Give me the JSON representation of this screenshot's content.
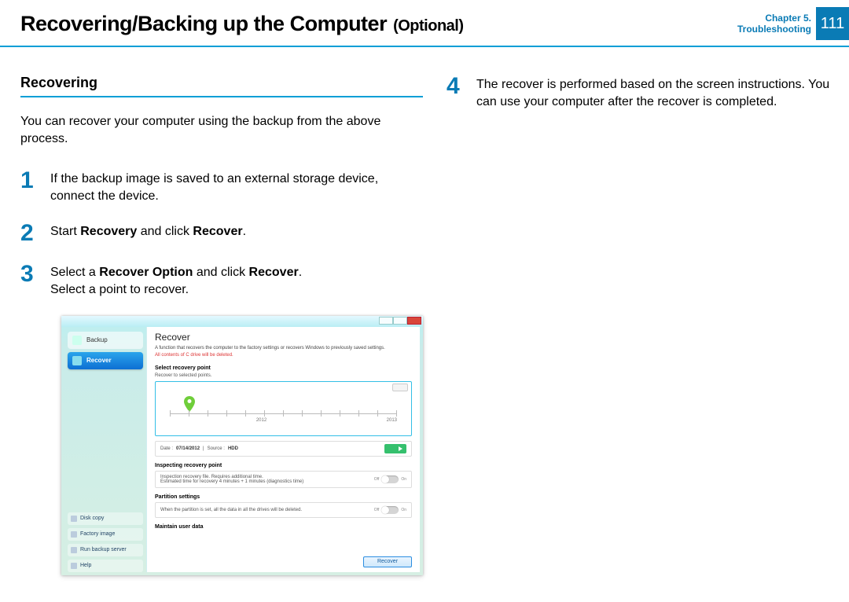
{
  "header": {
    "title": "Recovering/Backing up the Computer",
    "optional": "(Optional)",
    "chapter_line1": "Chapter 5.",
    "chapter_line2": "Troubleshooting",
    "page_number": "111"
  },
  "left": {
    "heading": "Recovering",
    "intro": "You can recover your computer using the backup from the above process.",
    "steps": [
      {
        "num": "1",
        "text_plain_a": "If the backup image is saved to an external storage device, connect the device."
      },
      {
        "num": "2",
        "text_a": "Start ",
        "b1": "Recovery",
        "text_b": " and click ",
        "b2": "Recover",
        "text_c": "."
      },
      {
        "num": "3",
        "text_a": "Select a ",
        "b1": "Recover Option",
        "text_b": " and click ",
        "b2": "Recover",
        "text_c": ".",
        "line2": "Select a point to recover."
      }
    ]
  },
  "right": {
    "steps": [
      {
        "num": "4",
        "text": "The recover is performed based on the screen instructions. You can use your computer after the recover is completed."
      }
    ]
  },
  "app": {
    "sidebar": {
      "items": [
        {
          "label": "Backup"
        },
        {
          "label": "Recover"
        }
      ],
      "links": [
        {
          "label": "Disk copy"
        },
        {
          "label": "Factory image"
        },
        {
          "label": "Run backup server"
        },
        {
          "label": "Help"
        }
      ]
    },
    "main": {
      "title": "Recover",
      "desc": "A function that recovers the computer to the factory settings or recovers Windows to previously saved settings.",
      "warn": "All contents of C drive will be deleted.",
      "select_point_label": "Select recovery point",
      "select_point_sub": "Recover to selected points.",
      "ticks": [
        "2012",
        "2013"
      ],
      "date_label": "Date :",
      "date_value": "07/14/2012",
      "source_label": "Source :",
      "source_value": "HDD",
      "inspecting_label": "Inspecting recovery point",
      "inspecting_desc": "Inspection recovery file. Requires additional time.\nEstimated time for recovery 4 minutes + 1 minutes (diagnostics time)",
      "partition_label": "Partition settings",
      "partition_desc": "When the partition is set, all the data in all the drives will be deleted.",
      "maintain_label": "Maintain user data",
      "toggle_off": "Off",
      "toggle_on": "On",
      "recover_btn": "Recover"
    }
  }
}
